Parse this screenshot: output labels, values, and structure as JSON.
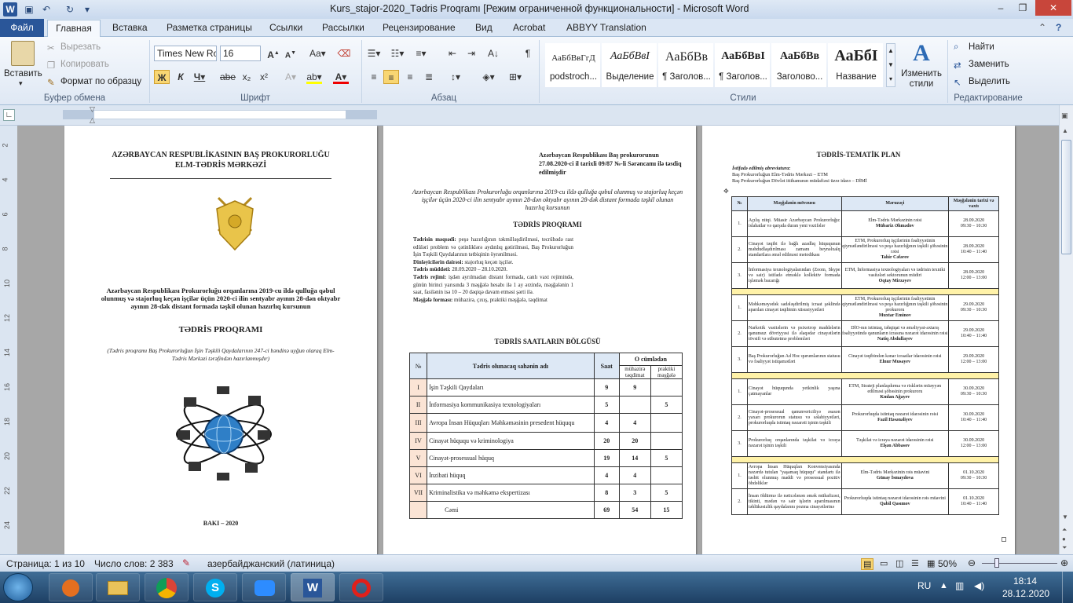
{
  "window": {
    "title": "Kurs_stajor-2020_Tədris Proqramı [Режим ограниченной функциональности]  -  Microsoft Word"
  },
  "ribbon_tabs": [
    "Файл",
    "Главная",
    "Вставка",
    "Разметка страницы",
    "Ссылки",
    "Рассылки",
    "Рецензирование",
    "Вид",
    "Acrobat",
    "ABBYY Translation"
  ],
  "clipboard": {
    "paste": "Вставить",
    "cut": "Вырезать",
    "copy": "Копировать",
    "format_painter": "Формат по образцу",
    "group": "Буфер обмена"
  },
  "font": {
    "name": "Times New Ro",
    "size": "16",
    "group": "Шрифт"
  },
  "paragraph": {
    "group": "Абзац"
  },
  "styles": {
    "group": "Стили",
    "items": [
      {
        "preview": "АаБбВвГгД",
        "name": "podstroch..."
      },
      {
        "preview": "АаБбВвІ",
        "name": "Выделение"
      },
      {
        "preview": "АаБбВв",
        "name": "¶ Заголов..."
      },
      {
        "preview": "АаБбВвІ",
        "name": "¶ Заголов..."
      },
      {
        "preview": "АаБбВв",
        "name": "Заголово..."
      },
      {
        "preview": "АаБбІ",
        "name": "Название"
      }
    ],
    "change_styles": "Изменить стили"
  },
  "editing": {
    "find": "Найти",
    "replace": "Заменить",
    "select": "Выделить",
    "group": "Редактирование"
  },
  "ruler_v": [
    "2",
    "4",
    "6",
    "8",
    "10",
    "12",
    "14",
    "16",
    "18",
    "20",
    "22",
    "24"
  ],
  "page1": {
    "org1": "AZƏRBAYCAN RESPUBLİKASININ BAŞ PROKURORLUĞU",
    "org2": "ELM-TƏDRİS MƏRKƏZİ",
    "subtitle": "Azərbaycan Respublikası Prokurorluğu orqanlarına 2019-cu ildə qulluğa qəbul olunmuş və stajorluq keçən işçilər üçün 2020-ci ilin sentyabr ayının 28-dən oktyabr ayının 28-dək distant formada təşkil olunan hazırlıq kursunun",
    "title": "TƏDRİS  PROQRAMI",
    "note": "(Tədris proqramı Baş Prokurorluğun İşin Təşkili Qaydalarının 247-ci bəndinə uyğun olaraq Elm-Tədris Mərkəzi tərəfindən hazırlanmışdır)",
    "city": "BAKI – 2020"
  },
  "page2": {
    "approval": "Azərbaycan Respublikası Baş prokurorunun 27.08.2020-ci il tarixli 09/87 №-li Sərəncamı ilə təsdiq edilmişdir",
    "intro": "Azərbaycan Respublikası Prokurorluğu orqanlarına 2019-cu ildə qulluğa qəbul olunmuş və stajorluq keçən işçilər üçün 2020-ci ilin sentyabr ayının 28-dən oktyabr ayının 28-dək distant formada təşkil olunan hazırlıq kursunun",
    "heading": "TƏDRİS PROQRAMI",
    "lines": [
      {
        "b": "Tədrisin məqsədi:",
        "t": " peşə hazırlığının təkmilləşdirilməsi, tecrübədə rast edüləri problem və çətinliklərə aydınlıq gətirilməsi, Baş Prokurorluğun İşin Təşkili Qaydalarının tətbiqinin öyrənilməsi."
      },
      {
        "b": "Dinləyicilərin dairəsi:",
        "t": " stajorluq keçən işçilər."
      },
      {
        "b": "Tədris müddəti:",
        "t": " 28.09.2020 – 28.10.2020."
      },
      {
        "b": "Tədris rejimi:",
        "t": " işdən ayrılmadan distant formada, canlı vaxt rejimində, günün birinci yarısında 3 məşğələ hesabı ilə 1 ay ərzində, məşğələnin 1 saat, fasilənin isə 10 – 20 dəqiqə davam etməsi şərti ilə."
      },
      {
        "b": "Məşğələ forması:",
        "t": " mühazirə, çıxış, praktiki məşğələ, təqdimat"
      }
    ],
    "table_title": "TƏDRİS SAATLARIN BÖLGÜSÜ",
    "table_head": {
      "num": "№",
      "name": "Tədris olunacaq sahənin adı",
      "hours": "Saat",
      "of_which": "O cümlədən",
      "lecture": "mühazirə təqdimat",
      "practice": "praktiki məşğələ"
    },
    "rows": [
      {
        "n": "I",
        "name": "İşin Təşkili Qaydaları",
        "h": "9",
        "l": "9",
        "p": ""
      },
      {
        "n": "II",
        "name": "İnformasiya kommunikasiya texnologiyaları",
        "h": "5",
        "l": "",
        "p": "5"
      },
      {
        "n": "III",
        "name": "Avropa İnsan Hüquqları Məhkəməsinin presedent hüququ",
        "h": "4",
        "l": "4",
        "p": ""
      },
      {
        "n": "IV",
        "name": "Cinayət hüququ və kriminologiya",
        "h": "20",
        "l": "20",
        "p": ""
      },
      {
        "n": "V",
        "name": "Cinayət-prosessual hüquq",
        "h": "19",
        "l": "14",
        "p": "5"
      },
      {
        "n": "VI",
        "name": "İnzibati hüquq",
        "h": "4",
        "l": "4",
        "p": ""
      },
      {
        "n": "VII",
        "name": "Kriminalistika və məhkəmə ekspertizası",
        "h": "8",
        "l": "3",
        "p": "5"
      },
      {
        "n": "",
        "name": "Cəmi",
        "h": "69",
        "l": "54",
        "p": "15"
      }
    ]
  },
  "page3": {
    "heading": "TƏDRİS-TEMATİK PLAN",
    "abbr_title": "İstifadə edilmiş abreviatura:",
    "abbr1": "Baş Prokurorluğun Elm-Tədris Mərkəzi – ETM",
    "abbr2": "Baş Prokurorluğun Dövlət ittihamının müdafiəsi üzrə idarə – DİMİ",
    "head": {
      "num": "№",
      "topic": "Məşğələnin mövzusu",
      "speaker": "Məruzəçi",
      "date": "Məşğələnin tarixi və vaxtı"
    },
    "groups": [
      [
        {
          "n": "1.",
          "topic": "Açılış nitqi. Müasir Azərbaycan Prokurorluğu: islahatlar və qarşıda duran yeni vəzifələr",
          "sp": "Elm-Tədris Mərkəzinin rəisi",
          "name": "Mübariz Əhmədov",
          "d": "28.09.2020",
          "t": "09:30 – 10:30"
        },
        {
          "n": "2.",
          "topic": "Cinayət təqibi ilə bağlı azadlıq hüququnun məhdudlaşdırılması zamanı beynəlxalq standartlara əməl edilməsi metodikası",
          "sp": "ETM, Prokurorluq işçilərinin fəaliyyətinin qiymətləndirilməsi və peşə hazırlığının təşkili şöbəsinin rəisi",
          "name": "Tahir Cəfərov",
          "d": "28.09.2020",
          "t": "10:40 – 11:40"
        },
        {
          "n": "3.",
          "topic": "İnformasiya texnologiyalarından (Zoom, Skype və sair) istifadə etməklə kollektiv formada işləmək bacarığı",
          "sp": "ETM, İnformasiya texnologiyaları və tədrisin texniki vasitələri sektorunun müdiri",
          "name": "Oqtay Mirzəyev",
          "d": "28.09.2020",
          "t": "12:00 – 13:00"
        }
      ],
      [
        {
          "n": "1.",
          "topic": "Məhkəməyədək sadələşdirilmiş icraat şəklində aparılan cinayət təqibinin xüsusiyyətləri",
          "sp": "ETM, Prokurorluq işçilərinin fəaliyyətinin qiymətləndirilməsi və peşə hazırlığının təşkili şöbəsinin prokuroru",
          "name": "Muxtar Eminov",
          "d": "29.09.2020",
          "t": "09:30 – 10:30"
        },
        {
          "n": "2.",
          "topic": "Narkotik vasitələrin və psixotrop maddələrin qanunsuz dövriyyəsi ilə əlaqədar cinayətlərin tövsifi və sübutetmə problemləri",
          "sp": "DİO-nın istintaq, təhqiqat və əməliyyat-axtarış fəaliyyətində qanunların icrasına nəzarət idarəsinin rəisi",
          "name": "Natiq Abdullayev",
          "d": "29.09.2020",
          "t": "10:40 – 11:40"
        },
        {
          "n": "3.",
          "topic": "Baş Prokurorluğun Ad Hoc qurumlarının statusu və fəaliyyət istiqamətləri",
          "sp": "Cinayət təqibindən kənar icraatlar idarəsinin rəisi",
          "name": "Elnur Musayev",
          "d": "29.09.2020",
          "t": "12:00 – 13:00"
        }
      ],
      [
        {
          "n": "1.",
          "topic": "Cinayət hüququnda yetkinlik yaşına çatmayanlar",
          "sp": "ETM, Strateji planlaşdırma və risklərin müəyyən edilməsi şöbəsinin prokuroru",
          "name": "Kmlan Ağayev",
          "d": "30.09.2020",
          "t": "09:30 – 10:30"
        },
        {
          "n": "2.",
          "topic": "Cinayət-prosessual qanunvericiliyə əsasən yaxarı prokurorun statusu və səlahiyyətləri, prokurorluqda istintaq nəzarəti işinin təşkili",
          "sp": "Prokurorluqda istintaq nəzarət idarəsinin rəisi",
          "name": "Fazil Həsənəliyev",
          "d": "30.09.2020",
          "t": "10:40 – 11:40"
        },
        {
          "n": "3.",
          "topic": "Prokurorluq orqanlarında təşkilat və icraya nəzarət işinin təşkili",
          "sp": "Təşkilat və icraya nəzarət idarəsinin rəisi",
          "name": "Elşən Abbasov",
          "d": "30.09.2020",
          "t": "12:00 – 13:00"
        }
      ],
      [
        {
          "n": "1.",
          "topic": "Avropa İnsan Hüquqları Konvensiyasında nəzərdə tutulan \"yaşamaq hüququ\" standartı ilə təsbit olunmuş maddi və prosessual pozitiv öhdəliklər",
          "sp": "Elm-Tədris Mərkəzinin rəis müavini",
          "name": "Günay İsmayılova",
          "d": "01.10.2020",
          "t": "09:30 – 10:30"
        },
        {
          "n": "2.",
          "topic": "İnsan öldürmə ilə nəticələnən əmək mühafizəsi, tikinti, mədən və sair işlərin aparılmasının təhlükəsizlik qaydalarını pozma cinayətlərinə",
          "sp": "Prokurorluqda istintaq nəzarət idarəsinin rəis müavini",
          "name": "Qabil Qasımov",
          "d": "01.10.2020",
          "t": "10:40 – 11:40"
        }
      ]
    ]
  },
  "status": {
    "page": "Страница: 1 из 10",
    "words": "Число слов: 2 383",
    "lang": "азербайджанский (латиница)",
    "zoom": "50%"
  },
  "tray": {
    "lang": "RU",
    "time": "18:14",
    "date": "28.12.2020"
  }
}
